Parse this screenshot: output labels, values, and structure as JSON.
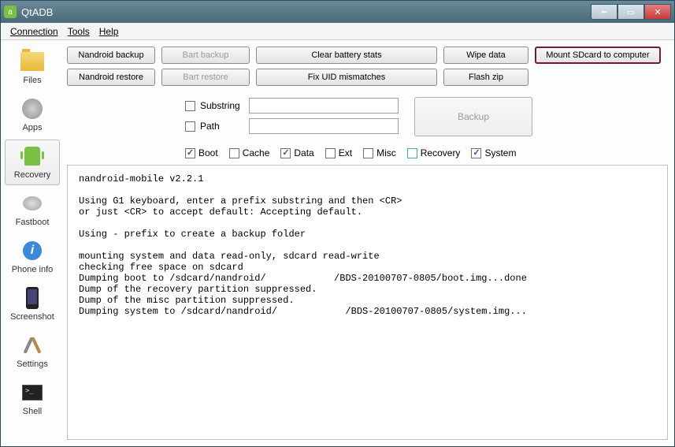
{
  "title": "QtADB",
  "menu": {
    "connection": "Connection",
    "tools": "Tools",
    "help": "Help"
  },
  "sidebar": [
    {
      "id": "files",
      "label": "Files"
    },
    {
      "id": "apps",
      "label": "Apps"
    },
    {
      "id": "recovery",
      "label": "Recovery",
      "selected": true
    },
    {
      "id": "fastboot",
      "label": "Fastboot"
    },
    {
      "id": "phoneinfo",
      "label": "Phone info"
    },
    {
      "id": "screenshot",
      "label": "Screenshot"
    },
    {
      "id": "settings",
      "label": "Settings"
    },
    {
      "id": "shell",
      "label": "Shell"
    }
  ],
  "buttons": {
    "nandroid_backup": "Nandroid backup",
    "bart_backup": "Bart backup",
    "clear_battery": "Clear battery stats",
    "wipe_data": "Wipe data",
    "mount_sd": "Mount SDcard to computer",
    "nandroid_restore": "Nandroid restore",
    "bart_restore": "Bart restore",
    "fix_uid": "Fix UID mismatches",
    "flash_zip": "Flash zip",
    "backup": "Backup"
  },
  "options": {
    "substring_label": "Substring",
    "path_label": "Path",
    "boot_label": "Boot",
    "cache_label": "Cache",
    "data_label": "Data",
    "ext_label": "Ext",
    "misc_label": "Misc",
    "recovery_label": "Recovery",
    "system_label": "System",
    "substring_checked": false,
    "path_checked": false,
    "boot_checked": true,
    "cache_checked": false,
    "data_checked": true,
    "ext_checked": false,
    "misc_checked": false,
    "recovery_checked": false,
    "system_checked": true,
    "substring_value": "",
    "path_value": ""
  },
  "console": "nandroid-mobile v2.2.1\n\nUsing G1 keyboard, enter a prefix substring and then <CR>\nor just <CR> to accept default: Accepting default.\n\nUsing - prefix to create a backup folder\n\nmounting system and data read-only, sdcard read-write\nchecking free space on sdcard\nDumping boot to /sdcard/nandroid/            /BDS-20100707-0805/boot.img...done\nDump of the recovery partition suppressed.\nDump of the misc partition suppressed.\nDumping system to /sdcard/nandroid/            /BDS-20100707-0805/system.img..."
}
